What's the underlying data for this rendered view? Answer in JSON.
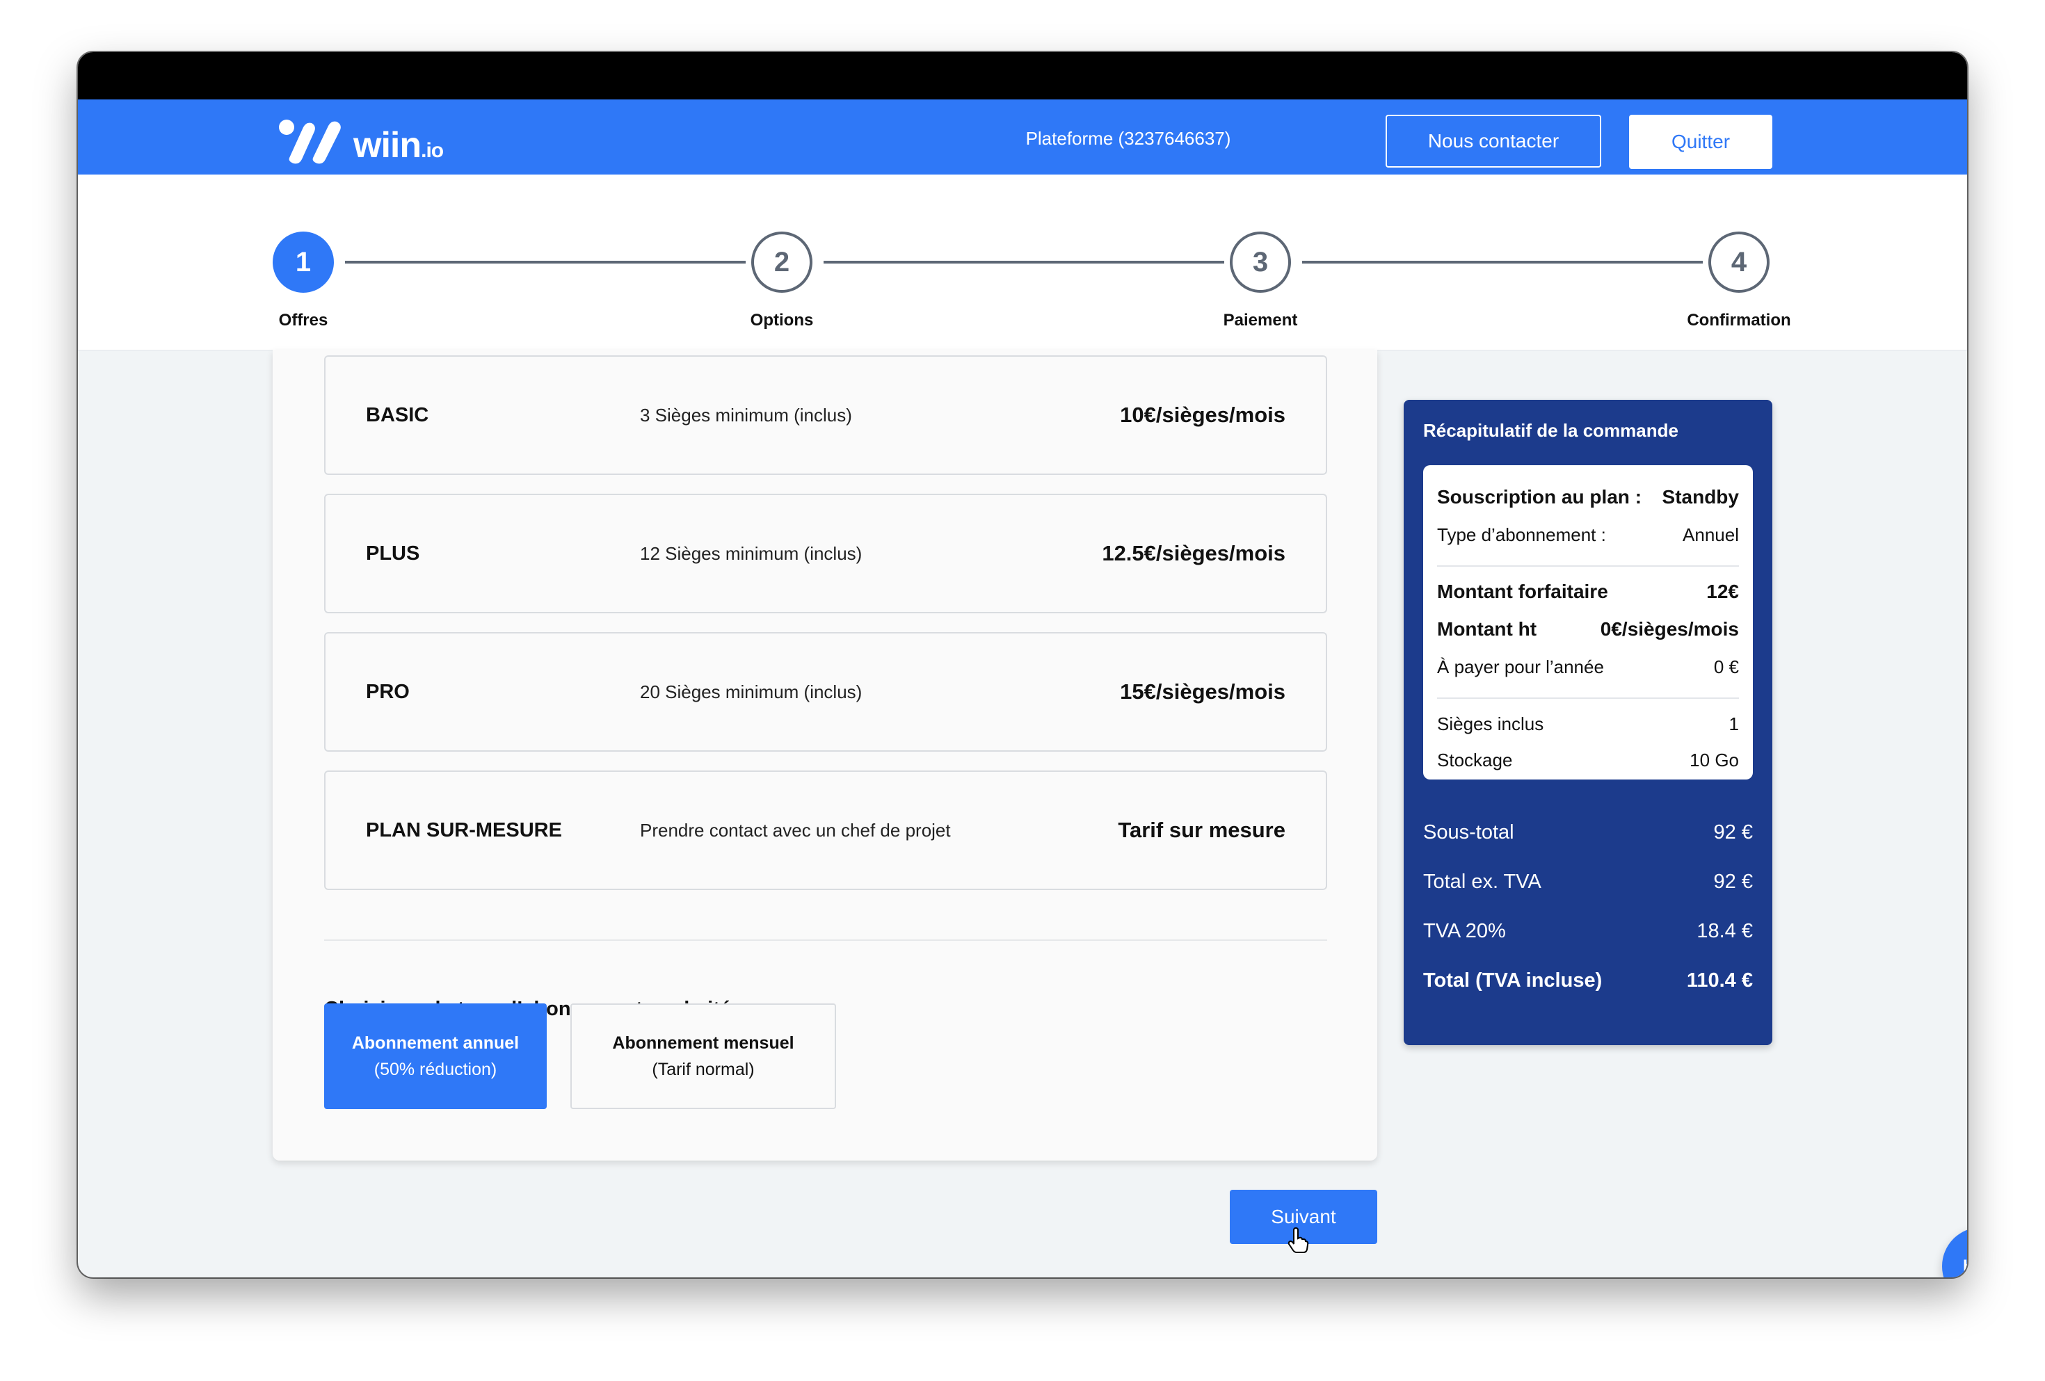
{
  "header": {
    "logo_text": "wiin",
    "logo_suffix": ".io",
    "platform_label": "Plateforme (3237646637)",
    "contact_label": "Nous contacter",
    "quit_label": "Quitter"
  },
  "stepper": {
    "current": 1,
    "steps": [
      {
        "number": "1",
        "label": "Offres"
      },
      {
        "number": "2",
        "label": "Options"
      },
      {
        "number": "3",
        "label": "Paiement"
      },
      {
        "number": "4",
        "label": "Confirmation"
      }
    ]
  },
  "plans": [
    {
      "name": "BASIC",
      "description": "3 Sièges minimum (inclus)",
      "price": "10€/sièges/mois"
    },
    {
      "name": "PLUS",
      "description": "12 Sièges minimum (inclus)",
      "price": "12.5€/sièges/mois"
    },
    {
      "name": "PRO",
      "description": "20 Sièges minimum (inclus)",
      "price": "15€/sièges/mois"
    },
    {
      "name": "PLAN SUR-MESURE",
      "description": "Prendre contact avec un chef de projet",
      "price": "Tarif sur mesure"
    }
  ],
  "subscription": {
    "title": "Choisissez le type d’abonnement souhaité",
    "selected": "annual",
    "annual": {
      "line1": "Abonnement annuel",
      "line2": "(50% réduction)"
    },
    "monthly": {
      "line1": "Abonnement mensuel",
      "line2": "(Tarif normal)"
    }
  },
  "next_label": "Suivant",
  "summary": {
    "title": "Récapitulatif de la commande",
    "plan_label": "Souscription au plan :",
    "plan_value": "Standby",
    "type_label": "Type d’abonnement :",
    "type_value": "Annuel",
    "flat_label": "Montant forfaitaire",
    "flat_value": "12€",
    "ht_label": "Montant ht",
    "ht_value": "0€/sièges/mois",
    "year_label": "À payer pour l’année",
    "year_value": "0 €",
    "seats_label": "Sièges inclus",
    "seats_value": "1",
    "storage_label": "Stockage",
    "storage_value": "10 Go",
    "subtotal_label": "Sous-total",
    "subtotal_value": "92 €",
    "excl_label": "Total ex. TVA",
    "excl_value": "92 €",
    "vat_label": "TVA 20%",
    "vat_value": "18.4 €",
    "total_label": "Total (TVA incluse)",
    "total_value": "110.4 €"
  },
  "help_label": "Help",
  "colors": {
    "primary": "#2f78f7",
    "summary_bg": "#1c3b8c",
    "step_idle": "#5d6775",
    "page_bg": "#f1f4f6"
  }
}
